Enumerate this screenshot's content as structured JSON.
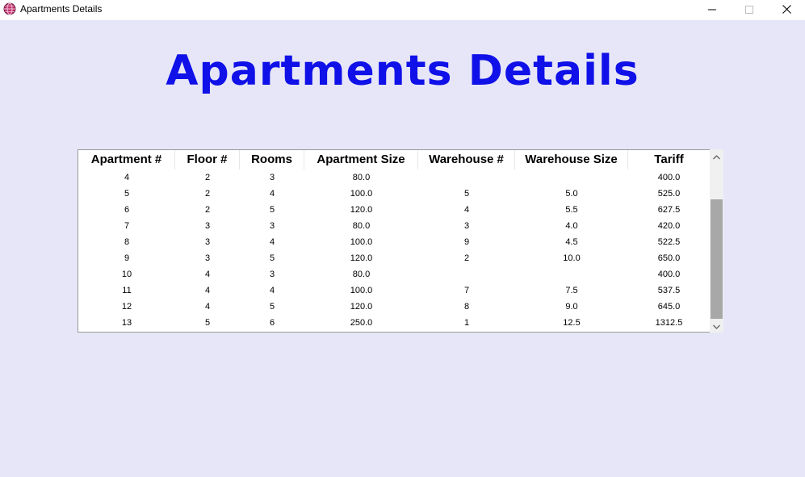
{
  "window": {
    "title": "Apartments Details",
    "icon": "app-globe-icon",
    "controls": {
      "minimize": "minimize-icon",
      "maximize": "maximize-icon",
      "close": "close-icon"
    }
  },
  "heading": "Apartments Details",
  "colors": {
    "background": "#e6e6f8",
    "heading": "#1010e8",
    "scroll_thumb": "#a8a8a8"
  },
  "table": {
    "columns": [
      "Apartment #",
      "Floor #",
      "Rooms",
      "Apartment Size",
      "Warehouse #",
      "Warehouse Size",
      "Tariff"
    ],
    "rows": [
      [
        "4",
        "2",
        "3",
        "80.0",
        "",
        "",
        "400.0"
      ],
      [
        "5",
        "2",
        "4",
        "100.0",
        "5",
        "5.0",
        "525.0"
      ],
      [
        "6",
        "2",
        "5",
        "120.0",
        "4",
        "5.5",
        "627.5"
      ],
      [
        "7",
        "3",
        "3",
        "80.0",
        "3",
        "4.0",
        "420.0"
      ],
      [
        "8",
        "3",
        "4",
        "100.0",
        "9",
        "4.5",
        "522.5"
      ],
      [
        "9",
        "3",
        "5",
        "120.0",
        "2",
        "10.0",
        "650.0"
      ],
      [
        "10",
        "4",
        "3",
        "80.0",
        "",
        "",
        "400.0"
      ],
      [
        "11",
        "4",
        "4",
        "100.0",
        "7",
        "7.5",
        "537.5"
      ],
      [
        "12",
        "4",
        "5",
        "120.0",
        "8",
        "9.0",
        "645.0"
      ],
      [
        "13",
        "5",
        "6",
        "250.0",
        "1",
        "12.5",
        "1312.5"
      ]
    ]
  },
  "scrollbar": {
    "up_icon": "chevron-up-icon",
    "down_icon": "chevron-down-icon"
  }
}
